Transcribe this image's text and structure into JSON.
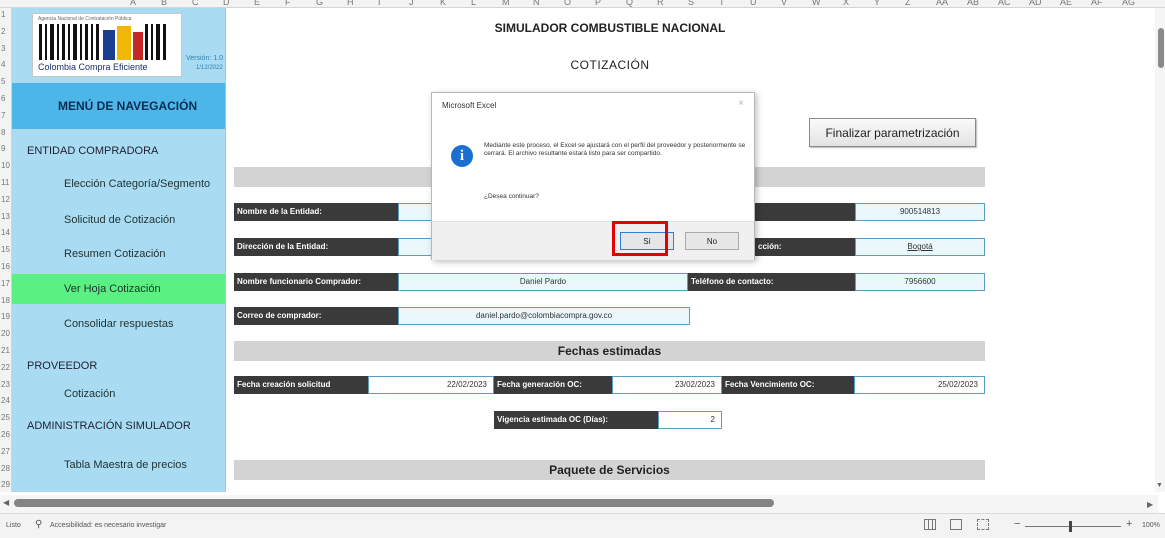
{
  "sheet": {
    "columns": [
      "A",
      "B",
      "C",
      "D",
      "E",
      "F",
      "G",
      "H",
      "I",
      "J",
      "K",
      "L",
      "M",
      "N",
      "O",
      "P",
      "Q",
      "R",
      "S",
      "T",
      "U",
      "V",
      "W",
      "X",
      "Y",
      "Z",
      "AA",
      "AB",
      "AC",
      "AD",
      "AE",
      "AF",
      "AG"
    ],
    "rows": [
      "1",
      "2",
      "3",
      "4",
      "5",
      "6",
      "7",
      "8",
      "9",
      "10",
      "11",
      "12",
      "13",
      "14",
      "15",
      "16",
      "17",
      "18",
      "19",
      "20",
      "21",
      "22",
      "23",
      "24",
      "25",
      "26",
      "27",
      "28",
      "29"
    ]
  },
  "logo": {
    "agency": "Agencia Nacional de Contratación Pública",
    "name": "Colombia Compra Eficiente",
    "version": "Versión: 1.0",
    "date": "1/12/2022"
  },
  "nav": {
    "title": "MENÚ DE NAVEGACIÓN",
    "sections": [
      "ENTIDAD COMPRADORA",
      "PROVEEDOR",
      "ADMINISTRACIÓN SIMULADOR"
    ],
    "items": [
      {
        "label": "Elección Categoría/Segmento"
      },
      {
        "label": "Solicitud de Cotización"
      },
      {
        "label": "Resumen Cotización"
      },
      {
        "label": "Ver Hoja Cotización"
      },
      {
        "label": "Consolidar respuestas"
      },
      {
        "label": "Cotización"
      },
      {
        "label": "Tabla Maestra de precios"
      }
    ],
    "active_item": "Ver Hoja Cotización"
  },
  "page": {
    "title": "SIMULADOR COMBUSTIBLE NACIONAL",
    "subtitle": "COTIZACIÓN",
    "finish_button": "Finalizar parametrización"
  },
  "form": {
    "entity_name_label": "Nombre de la Entidad:",
    "nit_value": "900514813",
    "address_label": "Dirección de la Entidad:",
    "city_label_suffix": "cción:",
    "city_value": "Bogotá",
    "official_label": "Nombre funcionario Comprador:",
    "official_value": "Daniel Pardo",
    "phone_label": "Teléfono de contacto:",
    "phone_value": "7956600",
    "email_label": "Correo de comprador:",
    "email_value": "daniel.pardo@colombiacompra.gov.co",
    "dates_header": "Fechas estimadas",
    "creation_label": "Fecha creación solicitud",
    "creation_value": "22/02/2023",
    "generation_label": "Fecha generación OC:",
    "generation_value": "23/02/2023",
    "expiry_label": "Fecha Vencimiento OC:",
    "expiry_value": "25/02/2023",
    "validity_label": "Vigencia estimada OC (Días):",
    "validity_value": "2",
    "services_header": "Paquete de Servicios"
  },
  "dialog": {
    "title": "Microsoft Excel",
    "close": "×",
    "icon": "i",
    "message": "Mediante este proceso, el Excel se ajustará con el perfil del proveedor y posteriormente se cerrará. El archivo resultante estará listo para ser compartido.",
    "question": "¿Desea continuar?",
    "yes": "Sí",
    "no": "No"
  },
  "status": {
    "ready": "Listo",
    "accessibility": "Accesibilidad: es necesario investigar",
    "zoom": "100%"
  },
  "colors": {
    "sidebar": "#a9dcf2",
    "nav_title": "#4db6e8",
    "active_item": "#5af082",
    "label_bg": "#3a3a3a",
    "highlight": "#e40000"
  }
}
